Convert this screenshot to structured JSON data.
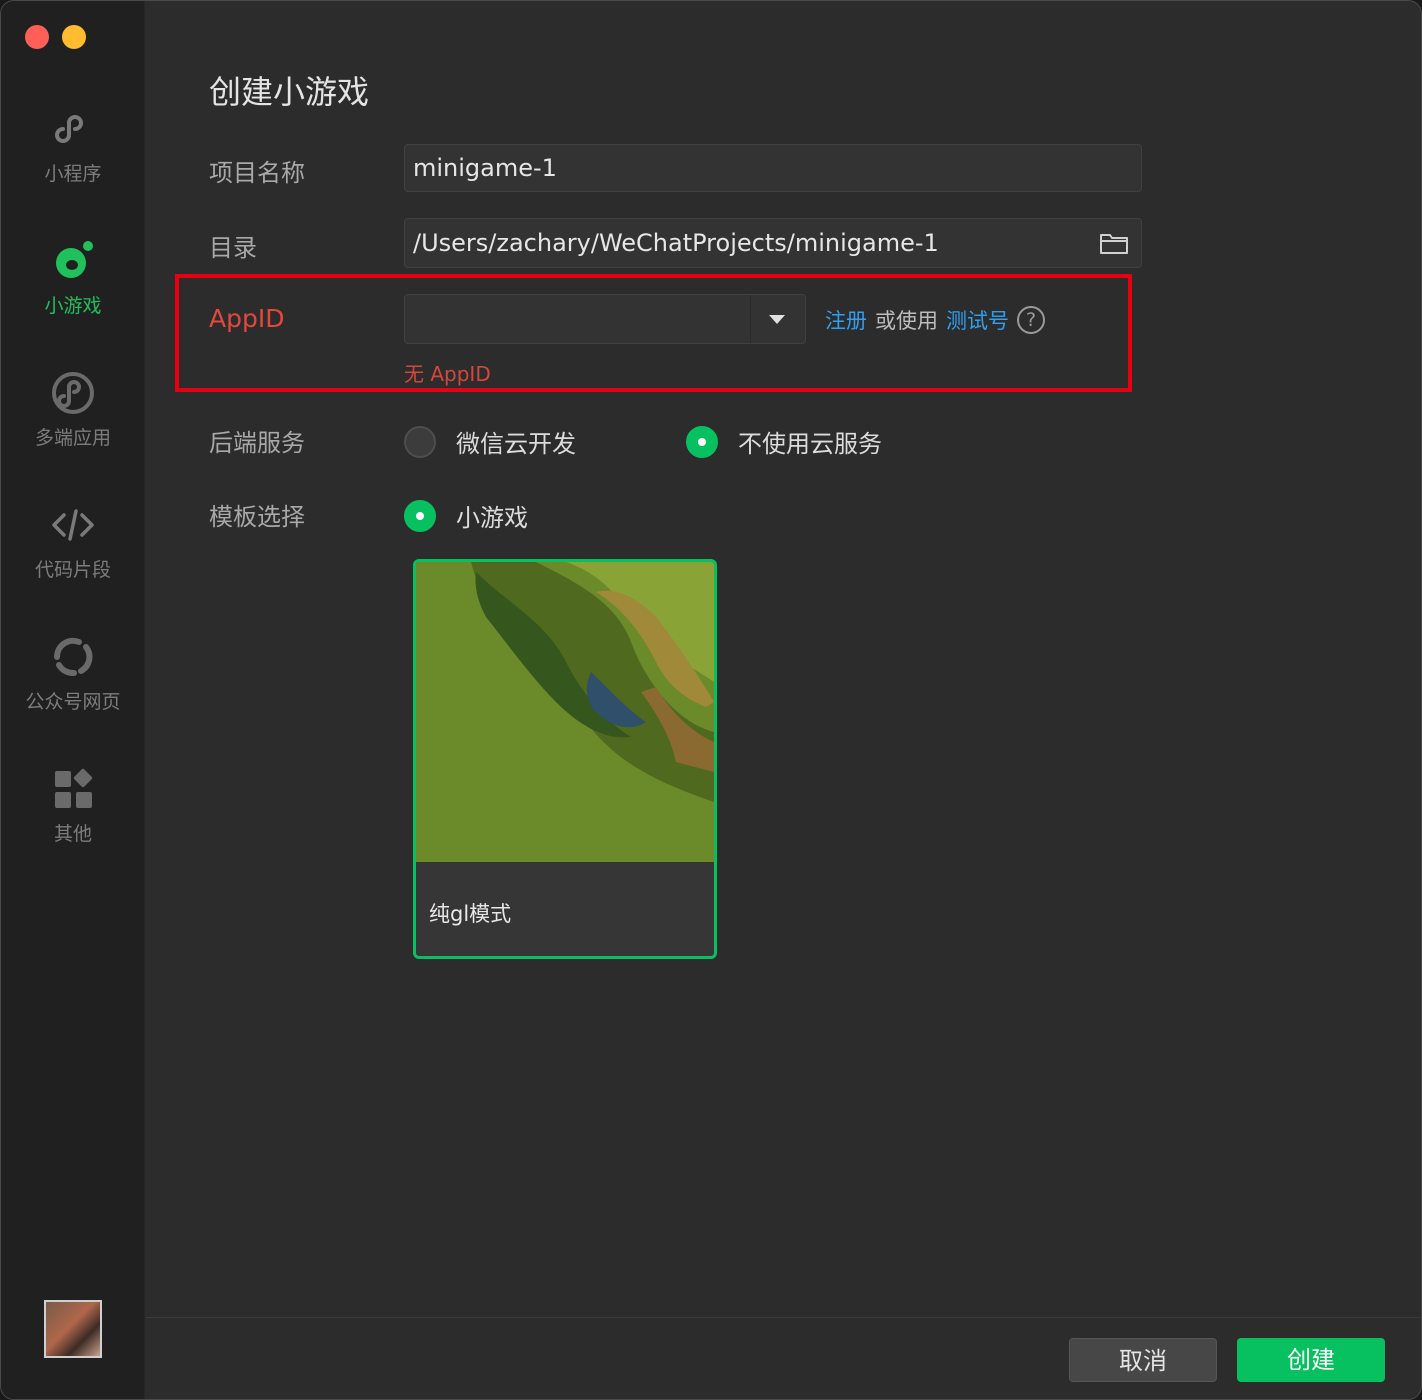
{
  "sidebar": {
    "items": [
      {
        "label": "小程序",
        "icon": "miniprogram-icon"
      },
      {
        "label": "小游戏",
        "icon": "minigame-icon",
        "active": true
      },
      {
        "label": "多端应用",
        "icon": "multi-platform-icon"
      },
      {
        "label": "代码片段",
        "icon": "code-icon"
      },
      {
        "label": "公众号网页",
        "icon": "web-icon"
      },
      {
        "label": "其他",
        "icon": "apps-icon"
      }
    ]
  },
  "page": {
    "title": "创建小游戏"
  },
  "form": {
    "project_name_label": "项目名称",
    "project_name_value": "minigame-1",
    "directory_label": "目录",
    "directory_value": "/Users/zachary/WeChatProjects/minigame-1",
    "appid_label": "AppID",
    "appid_value": "",
    "register_link": "注册",
    "or_use_text": "或使用",
    "test_account_link": "测试号",
    "help_symbol": "?",
    "appid_error": "无 AppID",
    "backend_label": "后端服务",
    "backend_options": [
      {
        "label": "微信云开发",
        "checked": false
      },
      {
        "label": "不使用云服务",
        "checked": true
      }
    ],
    "template_label": "模板选择",
    "template_option": {
      "label": "小游戏",
      "checked": true
    },
    "template_card_name": "纯gl模式"
  },
  "footer": {
    "cancel_label": "取消",
    "create_label": "创建"
  },
  "colors": {
    "accent": "#07c160",
    "error": "#e2483c",
    "link": "#2f9ff2",
    "highlight_border": "#e60012"
  }
}
